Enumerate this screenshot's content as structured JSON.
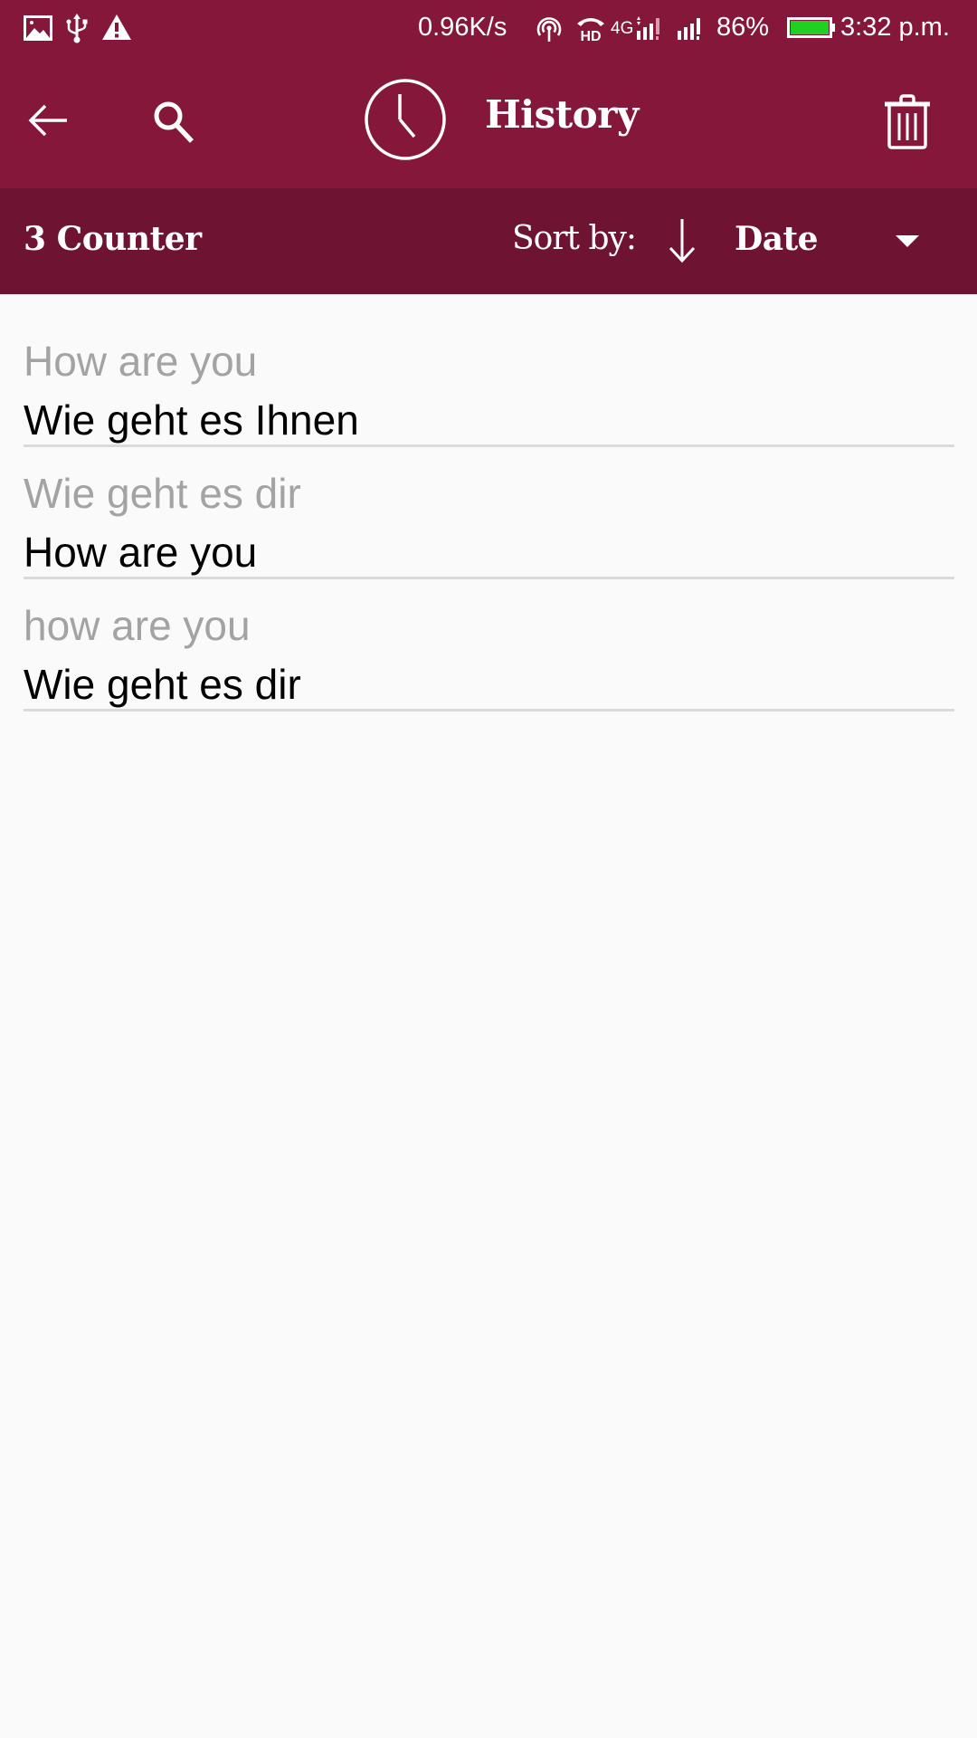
{
  "status_bar": {
    "left_icons": [
      "image-notification-icon",
      "usb-icon",
      "warning-icon"
    ],
    "network_speed": "0.96K/s",
    "right_icons": [
      "hotspot-icon",
      "hd-voice-icon",
      "signal-sim1-icon",
      "signal-sim2-icon",
      "battery-icon"
    ],
    "network_type": "4G",
    "battery_percent": "86%",
    "battery_level": 0.86,
    "time": "3:32 p.m.",
    "battery_color": "#22d022"
  },
  "toolbar": {
    "back_icon": "arrow-left-icon",
    "search_icon": "search-icon",
    "title_icon": "clock-icon",
    "title": "History",
    "delete_icon": "trash-icon"
  },
  "subheader": {
    "counter": "3 Counter",
    "sort_label": "Sort by:",
    "sort_direction_icon": "arrow-down-icon",
    "sort_value": "Date",
    "dropdown_icon": "caret-down-icon"
  },
  "history": [
    {
      "source": "How are you",
      "translation": "Wie geht es Ihnen"
    },
    {
      "source": "Wie geht es dir",
      "translation": "How are you"
    },
    {
      "source": "how are you",
      "translation": "Wie geht es dir"
    }
  ],
  "colors": {
    "toolbar": "#84173a",
    "subheader": "#6e1331",
    "background": "#fafafa",
    "source_text": "#a3a3a3",
    "translation_text": "#000000",
    "divider": "#dadada"
  }
}
